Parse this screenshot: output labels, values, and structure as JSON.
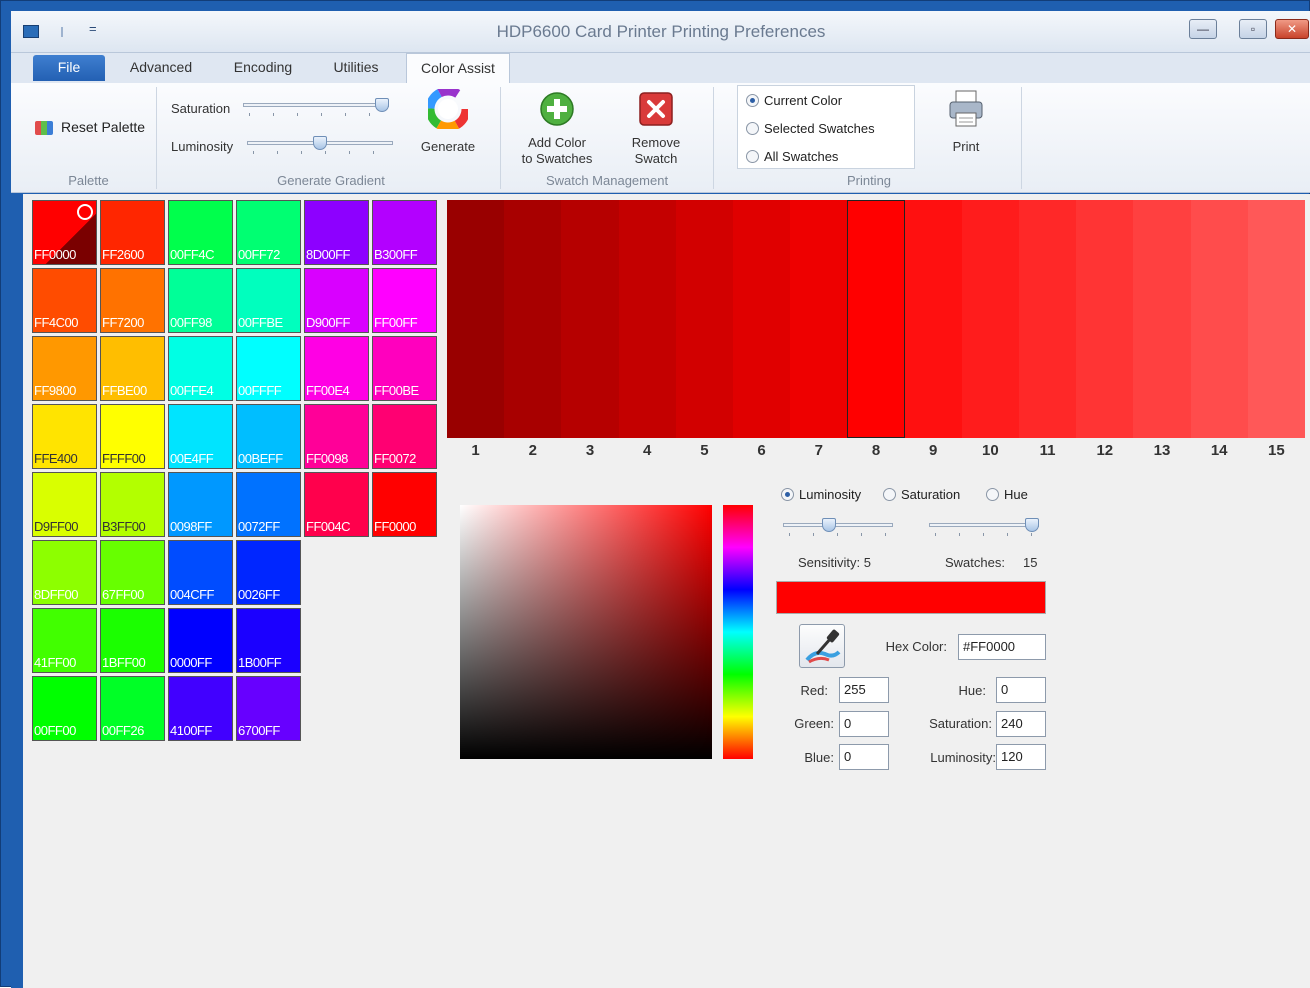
{
  "window": {
    "title": "HDP6600 Card Printer Printing Preferences",
    "quick_access_menu": "="
  },
  "tabs": [
    {
      "label": "File"
    },
    {
      "label": "Advanced"
    },
    {
      "label": "Encoding"
    },
    {
      "label": "Utilities"
    },
    {
      "label": "Color Assist",
      "selected": true
    }
  ],
  "ribbon": {
    "palette": {
      "reset_label": "Reset Palette",
      "group_label": "Palette"
    },
    "generate_gradient": {
      "saturation_label": "Saturation",
      "saturation_value": 1.0,
      "luminosity_label": "Luminosity",
      "luminosity_value": 0.5,
      "generate_label": "Generate",
      "group_label": "Generate Gradient"
    },
    "swatch_management": {
      "add_label_1": "Add Color",
      "add_label_2": "to Swatches",
      "remove_label_1": "Remove",
      "remove_label_2": "Swatch",
      "group_label": "Swatch Management"
    },
    "printing": {
      "options": [
        "Current Color",
        "Selected Swatches",
        "All Swatches"
      ],
      "selected": "Current Color",
      "print_label": "Print",
      "group_label": "Printing"
    }
  },
  "palette": {
    "selected": "FF0000",
    "rows": [
      [
        "FF0000",
        "FF2600",
        "00FF4C",
        "00FF72",
        "8D00FF",
        "B300FF"
      ],
      [
        "FF4C00",
        "FF7200",
        "00FF98",
        "00FFBE",
        "D900FF",
        "FF00FF"
      ],
      [
        "FF9800",
        "FFBE00",
        "00FFE4",
        "00FFFF",
        "FF00E4",
        "FF00BE"
      ],
      [
        "FFE400",
        "FFFF00",
        "00E4FF",
        "00BEFF",
        "FF0098",
        "FF0072"
      ],
      [
        "D9FF00",
        "B3FF00",
        "0098FF",
        "0072FF",
        "FF004C",
        "FF0000"
      ],
      [
        "8DFF00",
        "67FF00",
        "004CFF",
        "0026FF"
      ],
      [
        "41FF00",
        "1BFF00",
        "0000FF",
        "1B00FF"
      ],
      [
        "00FF00",
        "00FF26",
        "4100FF",
        "6700FF"
      ]
    ]
  },
  "gradient_strip": {
    "colors": [
      "#990000",
      "#a80000",
      "#b60000",
      "#c40000",
      "#d20000",
      "#e00000",
      "#ee0000",
      "#ff0000",
      "#ff1010",
      "#ff1c1c",
      "#ff2828",
      "#ff3434",
      "#ff4040",
      "#ff4c4c",
      "#ff5858"
    ],
    "labels": [
      "1",
      "2",
      "3",
      "4",
      "5",
      "6",
      "7",
      "8",
      "9",
      "10",
      "11",
      "12",
      "13",
      "14",
      "15"
    ],
    "selected_index": 7
  },
  "color_editor": {
    "modes": [
      "Luminosity",
      "Saturation",
      "Hue"
    ],
    "selected_mode": "Luminosity",
    "sensitivity_label": "Sensitivity: 5",
    "sensitivity_value": 5,
    "swatches_label": "Swatches:",
    "swatches_value": "15",
    "preview_color": "#ff0000",
    "hex_label": "Hex Color:",
    "hex_value": "#FF0000",
    "red_label": "Red:",
    "red_value": "255",
    "green_label": "Green:",
    "green_value": "0",
    "blue_label": "Blue:",
    "blue_value": "0",
    "hue_label": "Hue:",
    "hue_value": "0",
    "saturation_label": "Saturation:",
    "saturation_value": "240",
    "luminosity_label": "Luminosity:",
    "luminosity_value": "120"
  }
}
